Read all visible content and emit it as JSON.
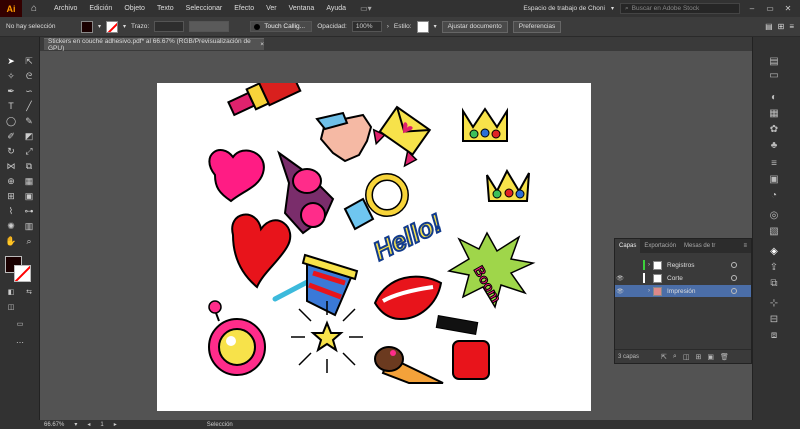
{
  "app": {
    "logo": "Ai",
    "home_icon": "home-icon"
  },
  "menu": [
    "Archivo",
    "Edición",
    "Objeto",
    "Texto",
    "Seleccionar",
    "Efecto",
    "Ver",
    "Ventana",
    "Ayuda"
  ],
  "workspace": {
    "label": "Espacio de trabajo de Choni",
    "search_placeholder": "Buscar en Adobe Stock"
  },
  "control": {
    "selection_status": "No hay selección",
    "stroke_label": "Trazo:",
    "brush_name": "Touch Callig...",
    "opacity_label": "Opacidad:",
    "opacity_value": "100%",
    "style_label": "Estilo:",
    "doc_setup": "Ajustar documento",
    "preferences": "Preferencias"
  },
  "document": {
    "tab_title": "Stickers en couché adhesivo.pdf* al 66.67% (RGB/Previsualización de GPU)",
    "close": "×"
  },
  "layers_panel": {
    "tabs": [
      "Capas",
      "Exportación",
      "Mesas de tr"
    ],
    "rows": [
      {
        "name": "Registros",
        "color": "#3cd23c"
      },
      {
        "name": "Corte",
        "color": "#ffffff"
      },
      {
        "name": "Impresión",
        "color": "#4b6ea8"
      }
    ],
    "count": "3 capas"
  },
  "status": {
    "zoom": "66.67%",
    "page": "1",
    "tool": "Selección"
  },
  "colors": {
    "accent": "#4b6ea8",
    "fill": "#1a0000",
    "stroke": "#ff0000"
  }
}
